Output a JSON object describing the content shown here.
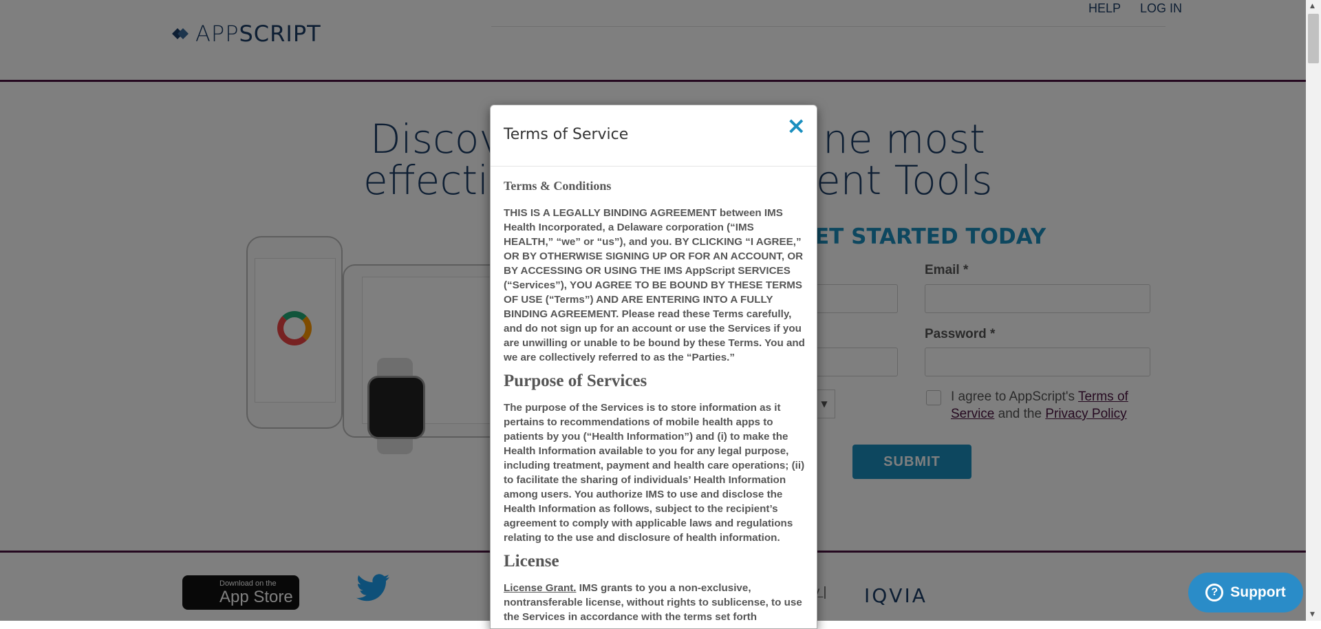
{
  "header": {
    "logo_text_app": "APP",
    "logo_text_script": "SCRIPT",
    "nav": [
      "HELP",
      "LOG IN"
    ]
  },
  "hero": {
    "title_line1": "Discover the most",
    "title_line2": "effective Management Tools",
    "visible_title_left1": "Discove",
    "visible_title_right1": "ne most",
    "visible_title_left2": "effective",
    "visible_title_right2": "ent Tools"
  },
  "form": {
    "get_started": "ET STARTED TODAY",
    "email_label": "Email *",
    "password_label": "Password *",
    "agree_prefix": "I agree to AppScript's",
    "terms_link": "Terms of Service",
    "and_text": "and the",
    "privacy_link": "Privacy Policy",
    "submit_label": "SUBMIT",
    "dropdown_arrow": "▼"
  },
  "footer": {
    "appstore_small": "Download on the",
    "appstore_big": "App Store",
    "policy_link_partial": "icy |",
    "iqvia": "IQVIA"
  },
  "modal": {
    "title": "Terms of Service",
    "close_symbol": "×",
    "section1_heading": "Terms & Conditions",
    "section1_text": "THIS IS A LEGALLY BINDING AGREEMENT between IMS Health Incorporated, a Delaware corporation (“IMS HEALTH,” “we” or “us”), and you. BY CLICKING “I AGREE,” OR BY OTHERWISE SIGNING UP OR FOR AN ACCOUNT, OR BY ACCESSING OR USING THE IMS AppScript SERVICES (“Services”), YOU AGREE TO BE BOUND BY THESE TERMS OF USE (“Terms”) AND ARE ENTERING INTO A FULLY BINDING AGREEMENT. Please read these Terms carefully, and do not sign up for an account or use the Services if you are unwilling or unable to be bound by these Terms. You and we are collectively referred to as the “Parties.”",
    "section2_heading": "Purpose of Services",
    "section2_text": "The purpose of the Services is to store information as it pertains to recommendations of mobile health apps to patients by you (“Health Information”) and (i) to make the Health Information available to you for any legal purpose, including treatment, payment and health care operations; (ii) to facilitate the sharing of individuals’ Health Information among users. You authorize IMS to use and disclose the Health Information as follows, subject to the recipient’s agreement to comply with applicable laws and regulations relating to the use and disclosure of health information.",
    "section3_heading": "License",
    "section3_underlined": "License Grant.",
    "section3_text": " IMS grants to you a non-exclusive, nontransferable license, without rights to sublicense, to use the Services in accordance with the terms set forth"
  },
  "support": {
    "label": "Support",
    "icon_glyph": "?"
  },
  "colors": {
    "brand_navy": "#1b3d66",
    "accent_blue": "#1a8fbf",
    "brand_purple": "#4a1240",
    "support_blue": "#2a8cc8"
  }
}
